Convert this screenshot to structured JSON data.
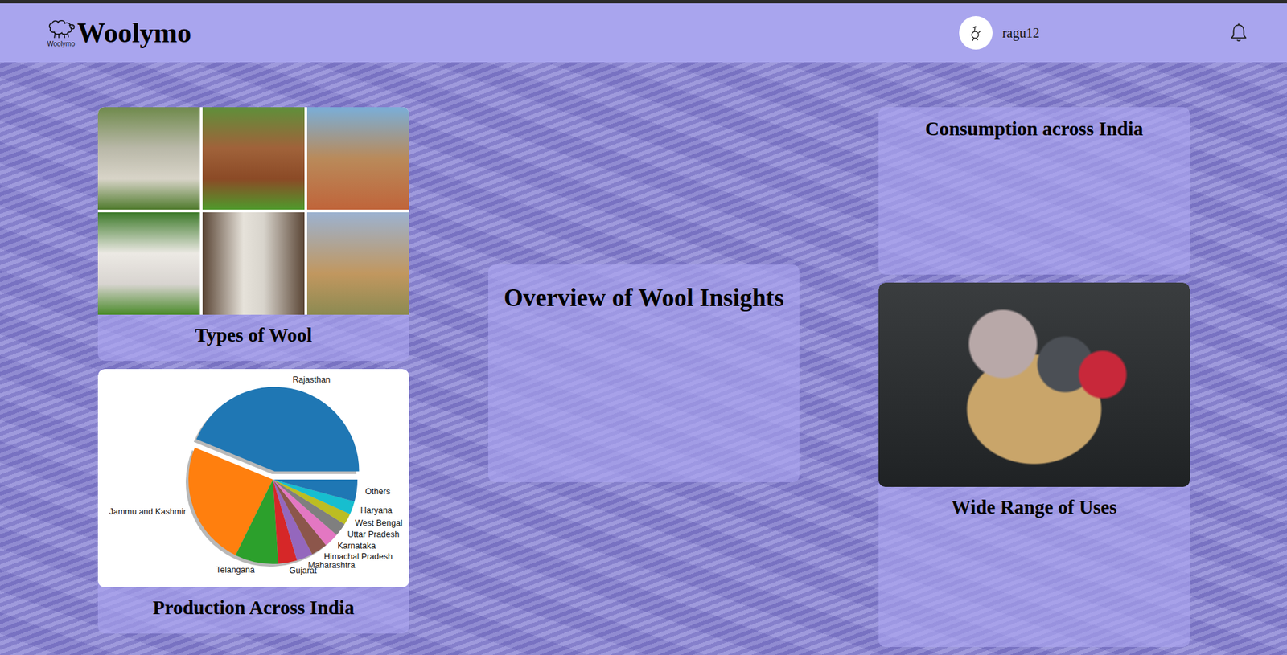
{
  "header": {
    "logo_caption": "Woolymo",
    "brand": "Woolymo",
    "username": "ragu12"
  },
  "cards": {
    "types": {
      "title": "Types of Wool"
    },
    "production": {
      "title": "Production Across India"
    },
    "overview": {
      "title": "Overview of Wool Insights"
    },
    "consumption": {
      "title": "Consumption across India"
    },
    "uses": {
      "title": "Wide Range of Uses"
    }
  },
  "chart": {
    "slices": [
      {
        "label": "Rajasthan",
        "value": 43.8,
        "color": "#1f77b4",
        "exploded": true
      },
      {
        "label": "Jammu and Kashmir",
        "value": 23.9,
        "color": "#ff7f0e",
        "exploded": false
      },
      {
        "label": "Telangana",
        "value": 8.3,
        "color": "#2ca02c",
        "exploded": false
      },
      {
        "label": "Gujarat",
        "value": 3.6,
        "color": "#d62728",
        "exploded": false
      },
      {
        "label": "Maharashtra",
        "value": 3.1,
        "color": "#9467bd",
        "exploded": false
      },
      {
        "label": "Himachal Pradesh",
        "value": 3.1,
        "color": "#8c564b",
        "exploded": false
      },
      {
        "label": "Karnataka",
        "value": 2.8,
        "color": "#e377c2",
        "exploded": false
      },
      {
        "label": "Uttar Pradesh",
        "value": 2.5,
        "color": "#7f7f7f",
        "exploded": false
      },
      {
        "label": "West Bengal",
        "value": 2.2,
        "color": "#bcbd22",
        "exploded": false
      },
      {
        "label": "Haryana",
        "value": 2.5,
        "color": "#17becf",
        "exploded": false
      },
      {
        "label": "Others",
        "value": 4.2,
        "color": "#1f77b4",
        "exploded": false
      }
    ]
  }
}
